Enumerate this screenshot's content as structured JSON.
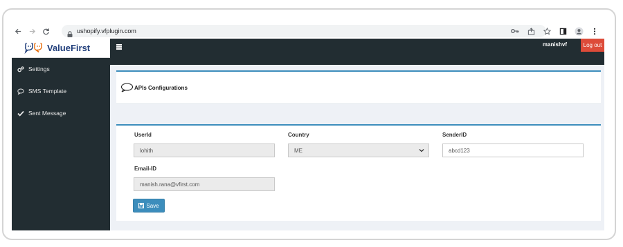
{
  "browser": {
    "url": "ushopify.vfplugin.com"
  },
  "brand": {
    "name": "ValueFirst",
    "accent": "#3c8dbc",
    "sidebar_bg": "#222d32",
    "logout_color": "#dd4b39"
  },
  "sidebar": {
    "items": [
      {
        "label": "Settings",
        "icon": "gears-icon"
      },
      {
        "label": "SMS Template",
        "icon": "comment-icon"
      },
      {
        "label": "Sent Message",
        "icon": "check-icon"
      }
    ]
  },
  "topnav": {
    "username": "manishvf",
    "logout_label": "Log out"
  },
  "header_card": {
    "title": "APIs Configurations"
  },
  "form": {
    "userid_label": "UserId",
    "userid_value": "lohith",
    "country_label": "Country",
    "country_value": "ME",
    "senderid_label": "SenderID",
    "senderid_value": "abcd123",
    "email_label": "Email-ID",
    "email_value": "manish.rana@vfirst.com",
    "save_label": "Save"
  }
}
